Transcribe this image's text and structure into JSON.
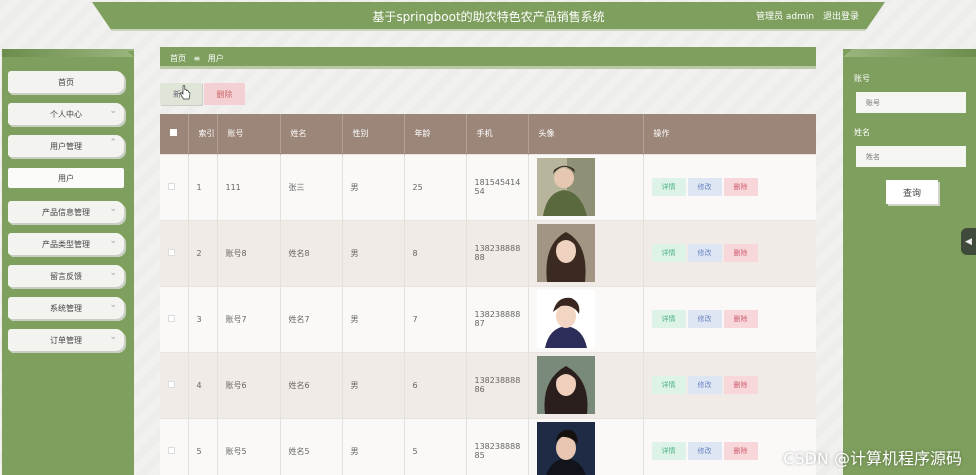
{
  "header": {
    "title": "基于springboot的助农特色农产品销售系统",
    "user": "管理员 admin",
    "logout": "退出登录"
  },
  "sidebar": {
    "items": [
      {
        "label": "首页",
        "chevron": false
      },
      {
        "label": "个人中心",
        "chevron": true
      },
      {
        "label": "用户管理",
        "chevron": true
      },
      {
        "label": "用户",
        "sub": true
      },
      {
        "label": "产品信息管理",
        "chevron": true
      },
      {
        "label": "产品类型管理",
        "chevron": true
      },
      {
        "label": "留言反馈",
        "chevron": true
      },
      {
        "label": "系统管理",
        "chevron": true
      },
      {
        "label": "订单管理",
        "chevron": true
      }
    ]
  },
  "breadcrumb": {
    "home": "首页",
    "sep": "≡",
    "current": "用户"
  },
  "toolbar": {
    "add": "新增",
    "delete": "删除"
  },
  "search": {
    "account_label": "账号",
    "account_placeholder": "账号",
    "name_label": "姓名",
    "name_placeholder": "姓名",
    "button": "查询"
  },
  "table": {
    "headers": [
      "索引",
      "账号",
      "姓名",
      "性别",
      "年龄",
      "手机",
      "头像",
      "操作"
    ],
    "rows": [
      {
        "index": "1",
        "account": "111",
        "name": "张三",
        "gender": "男",
        "age": "25",
        "phone": "18154541454"
      },
      {
        "index": "2",
        "account": "账号8",
        "name": "姓名8",
        "gender": "男",
        "age": "8",
        "phone": "13823888888"
      },
      {
        "index": "3",
        "account": "账号7",
        "name": "姓名7",
        "gender": "男",
        "age": "7",
        "phone": "13823888887"
      },
      {
        "index": "4",
        "account": "账号6",
        "name": "姓名6",
        "gender": "男",
        "age": "6",
        "phone": "13823888886"
      },
      {
        "index": "5",
        "account": "账号5",
        "name": "姓名5",
        "gender": "男",
        "age": "5",
        "phone": "13823888885"
      }
    ],
    "ops": {
      "detail": "详情",
      "edit": "修改",
      "delete": "删除"
    }
  },
  "watermark": "CSDN @计算机程序源码",
  "colors": {
    "primary": "#7e9f5d",
    "table_header": "#9c8679"
  }
}
